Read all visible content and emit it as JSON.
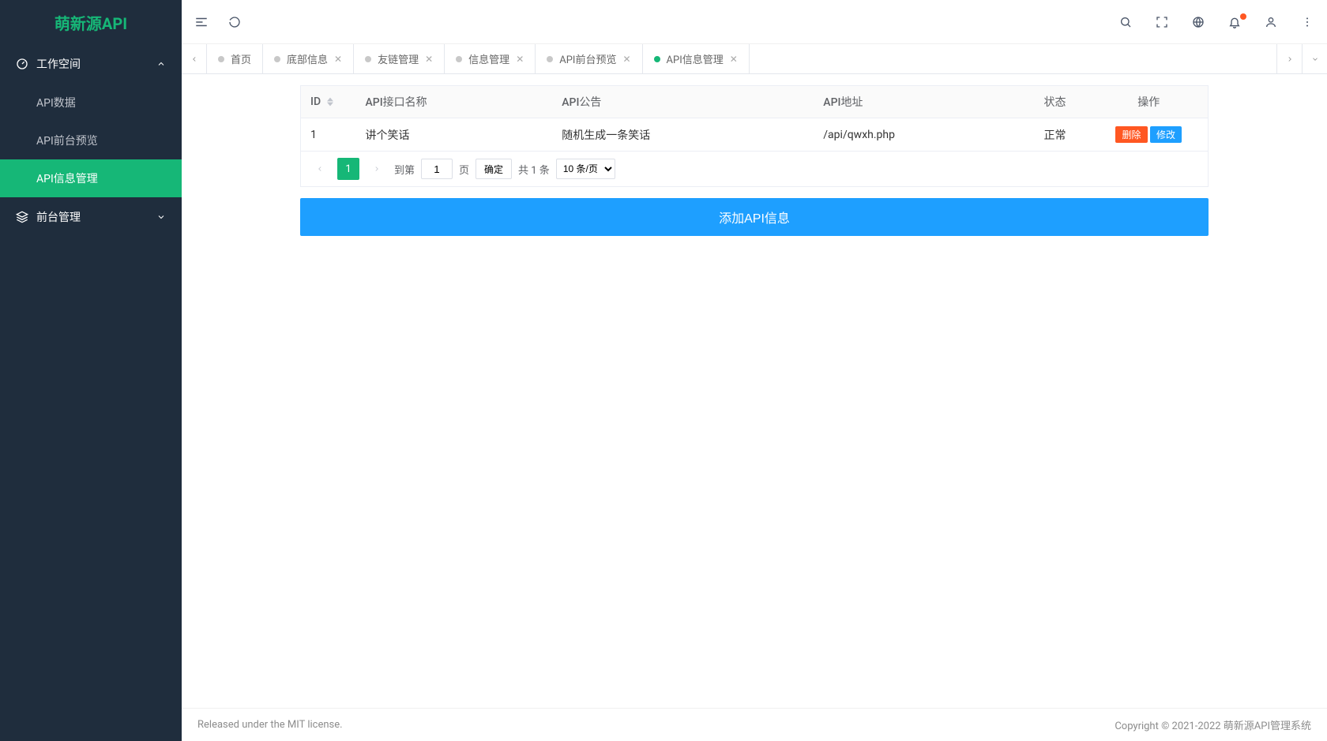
{
  "logo": "萌新源API",
  "sidebar": {
    "workspace": {
      "label": "工作空间",
      "expanded": true
    },
    "items": [
      {
        "label": "API数据"
      },
      {
        "label": "API前台预览"
      },
      {
        "label": "API信息管理",
        "active": true
      }
    ],
    "frontend": {
      "label": "前台管理",
      "expanded": false
    }
  },
  "tabs": [
    {
      "label": "首页",
      "closable": false,
      "active": false
    },
    {
      "label": "底部信息",
      "closable": true,
      "active": false
    },
    {
      "label": "友链管理",
      "closable": true,
      "active": false
    },
    {
      "label": "信息管理",
      "closable": true,
      "active": false
    },
    {
      "label": "API前台预览",
      "closable": true,
      "active": false
    },
    {
      "label": "API信息管理",
      "closable": true,
      "active": true
    }
  ],
  "table": {
    "headers": {
      "id": "ID",
      "name": "API接口名称",
      "notice": "API公告",
      "url": "API地址",
      "status": "状态",
      "action": "操作"
    },
    "rows": [
      {
        "id": "1",
        "name": "讲个笑话",
        "notice": "随机生成一条笑话",
        "url": "/api/qwxh.php",
        "status": "正常"
      }
    ],
    "actions": {
      "delete": "删除",
      "edit": "修改"
    }
  },
  "pagination": {
    "current": "1",
    "goto_prefix": "到第",
    "goto_input": "1",
    "goto_suffix": "页",
    "confirm": "确定",
    "total": "共 1 条",
    "perpage": "10 条/页"
  },
  "add_button": "添加API信息",
  "footer": {
    "left": "Released under the MIT license.",
    "right_prefix": "Copyright © 2021-2022 ",
    "right_link": "萌新源API管理系统"
  }
}
